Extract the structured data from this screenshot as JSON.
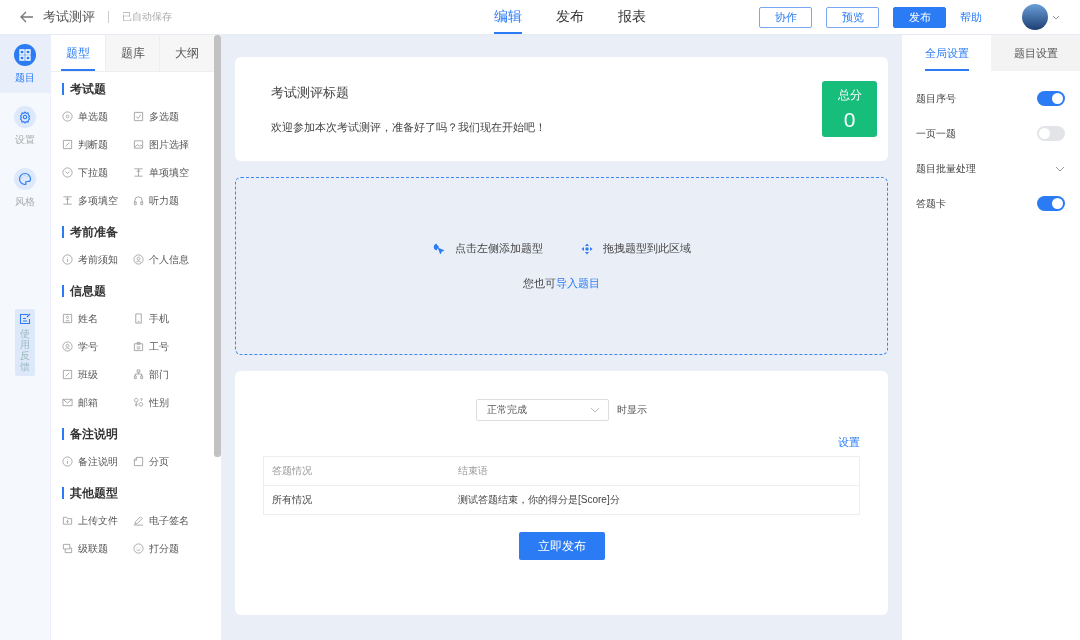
{
  "header": {
    "title": "考试测评",
    "save_status": "已自动保存",
    "nav": [
      {
        "label": "编辑",
        "selected": true
      },
      {
        "label": "发布",
        "selected": false
      },
      {
        "label": "报表",
        "selected": false
      }
    ],
    "buttons": [
      {
        "label": "协作",
        "kind": "outline"
      },
      {
        "label": "预览",
        "kind": "outline"
      },
      {
        "label": "发布",
        "kind": "primary"
      },
      {
        "label": "帮助",
        "kind": "link"
      }
    ]
  },
  "rail": {
    "items": [
      {
        "label": "题目",
        "kind": "apps",
        "selected": true
      },
      {
        "label": "设置",
        "kind": "gear",
        "selected": false
      },
      {
        "label": "风格",
        "kind": "palette",
        "selected": false
      }
    ],
    "feedback": "使用反馈"
  },
  "palette": {
    "tabs": [
      {
        "label": "题型",
        "selected": true
      },
      {
        "label": "题库",
        "selected": false
      },
      {
        "label": "大纲",
        "selected": false
      }
    ],
    "groups": [
      {
        "title": "考试题",
        "items": [
          {
            "label": "单选题",
            "kind": "radio"
          },
          {
            "label": "多选题",
            "kind": "check"
          },
          {
            "label": "判断题",
            "kind": "judge"
          },
          {
            "label": "图片选择",
            "kind": "image"
          },
          {
            "label": "下拉题",
            "kind": "dropdown"
          },
          {
            "label": "单项填空",
            "kind": "blank"
          },
          {
            "label": "多项填空",
            "kind": "blank"
          },
          {
            "label": "听力题",
            "kind": "audio"
          }
        ]
      },
      {
        "title": "考前准备",
        "items": [
          {
            "label": "考前须知",
            "kind": "info"
          },
          {
            "label": "个人信息",
            "kind": "person"
          }
        ]
      },
      {
        "title": "信息题",
        "items": [
          {
            "label": "姓名",
            "kind": "card"
          },
          {
            "label": "手机",
            "kind": "phone"
          },
          {
            "label": "学号",
            "kind": "person"
          },
          {
            "label": "工号",
            "kind": "badge"
          },
          {
            "label": "班级",
            "kind": "judge"
          },
          {
            "label": "部门",
            "kind": "org"
          },
          {
            "label": "邮箱",
            "kind": "mail"
          },
          {
            "label": "性别",
            "kind": "gender"
          }
        ]
      },
      {
        "title": "备注说明",
        "items": [
          {
            "label": "备注说明",
            "kind": "info"
          },
          {
            "label": "分页",
            "kind": "page"
          }
        ]
      },
      {
        "title": "其他题型",
        "items": [
          {
            "label": "上传文件",
            "kind": "folder"
          },
          {
            "label": "电子签名",
            "kind": "pen"
          },
          {
            "label": "级联题",
            "kind": "stack"
          },
          {
            "label": "打分题",
            "kind": "smile"
          }
        ]
      }
    ]
  },
  "intro": {
    "title": "考试测评标题",
    "description": "欢迎参加本次考试测评，准备好了吗？我们现在开始吧！",
    "score_label": "总分",
    "score": "0"
  },
  "drop_zone": {
    "hints": [
      {
        "label": "点击左侧添加题型",
        "kind": "click"
      },
      {
        "label": "拖拽题型到此区域",
        "kind": "drag"
      }
    ],
    "import_prefix": "您也可",
    "import_link": "导入题目"
  },
  "ending": {
    "condition": "正常完成",
    "condition_suffix": "时显示",
    "settings_link": "设置",
    "columns": [
      "答题情况",
      "结束语"
    ],
    "rows": [
      [
        "所有情况",
        "测试答题结束，你的得分是[Score]分"
      ]
    ],
    "publish_button": "立即发布"
  },
  "settings": {
    "tabs": [
      {
        "label": "全局设置",
        "selected": true
      },
      {
        "label": "题目设置",
        "selected": false
      }
    ],
    "items": [
      {
        "label": "题目序号",
        "kind": "toggle",
        "on": true
      },
      {
        "label": "一页一题",
        "kind": "toggle",
        "on": false
      },
      {
        "label": "题目批量处理",
        "kind": "expand"
      },
      {
        "label": "答题卡",
        "kind": "toggle",
        "on": true
      }
    ]
  }
}
